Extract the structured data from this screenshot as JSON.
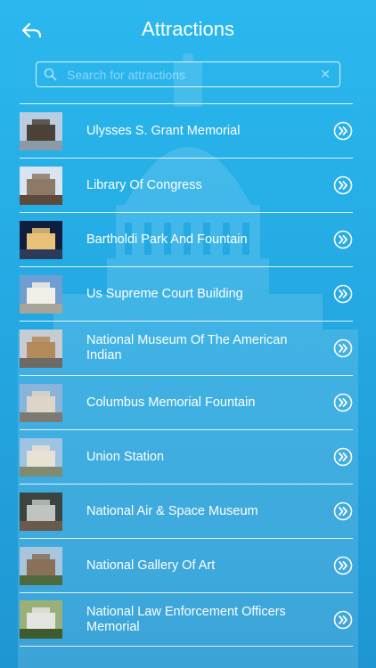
{
  "header": {
    "title": "Attractions"
  },
  "search": {
    "placeholder": "Search for attractions"
  },
  "attractions": [
    {
      "label": "Ulysses S. Grant Memorial",
      "colors": [
        "#b9cde0",
        "#4b4237",
        "#8a9aa8"
      ]
    },
    {
      "label": "Library Of Congress",
      "colors": [
        "#d8e4ef",
        "#8c7a66",
        "#5c4a3c"
      ]
    },
    {
      "label": "Bartholdi Park And Fountain",
      "colors": [
        "#0f1e3c",
        "#e9c27a",
        "#2e3a5c"
      ]
    },
    {
      "label": "Us Supreme Court Building",
      "colors": [
        "#6f9fd0",
        "#f1efe8",
        "#a7a49a"
      ]
    },
    {
      "label": "National Museum Of The American Indian",
      "colors": [
        "#c8ccd2",
        "#b48a5a",
        "#6d6a66"
      ]
    },
    {
      "label": "Columbus Memorial Fountain",
      "colors": [
        "#8ab4dc",
        "#ddd6c8",
        "#7c7a72"
      ]
    },
    {
      "label": "Union Station",
      "colors": [
        "#9fc3e2",
        "#e6e2d6",
        "#7f8a70"
      ]
    },
    {
      "label": "National Air & Space Museum",
      "colors": [
        "#3c4440",
        "#c0c4c0",
        "#6a5a4a"
      ]
    },
    {
      "label": "National Gallery Of Art",
      "colors": [
        "#a9c4dd",
        "#8a7058",
        "#4f6a3c"
      ]
    },
    {
      "label": "National Law Enforcement Officers Memorial",
      "colors": [
        "#9ab07a",
        "#e4e4e0",
        "#3f5a2c"
      ]
    }
  ]
}
